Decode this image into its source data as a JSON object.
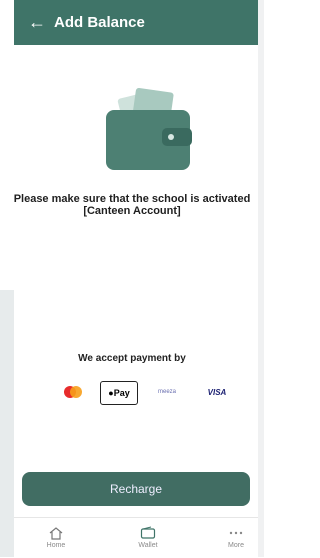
{
  "header": {
    "title": "Add Balance",
    "back_icon": "arrow-left-icon"
  },
  "notice": {
    "line1": "Please make sure that the school is activated",
    "line2": "[Canteen Account]"
  },
  "payment": {
    "accept_text": "We accept payment by",
    "methods": [
      {
        "name": "mastercard-icon"
      },
      {
        "name": "apple-pay-icon",
        "label": "Pay"
      },
      {
        "name": "meeza-icon",
        "label": "meeza"
      },
      {
        "name": "visa-icon",
        "label": "VISA"
      }
    ]
  },
  "recharge_button": {
    "label": "Recharge"
  },
  "bottom_nav": [
    {
      "label": "Home",
      "icon": "home-icon"
    },
    {
      "label": "Wallet",
      "icon": "wallet-icon"
    },
    {
      "label": "More",
      "icon": "more-icon"
    }
  ],
  "colors": {
    "primary": "#3f7468",
    "button": "#416d63"
  }
}
